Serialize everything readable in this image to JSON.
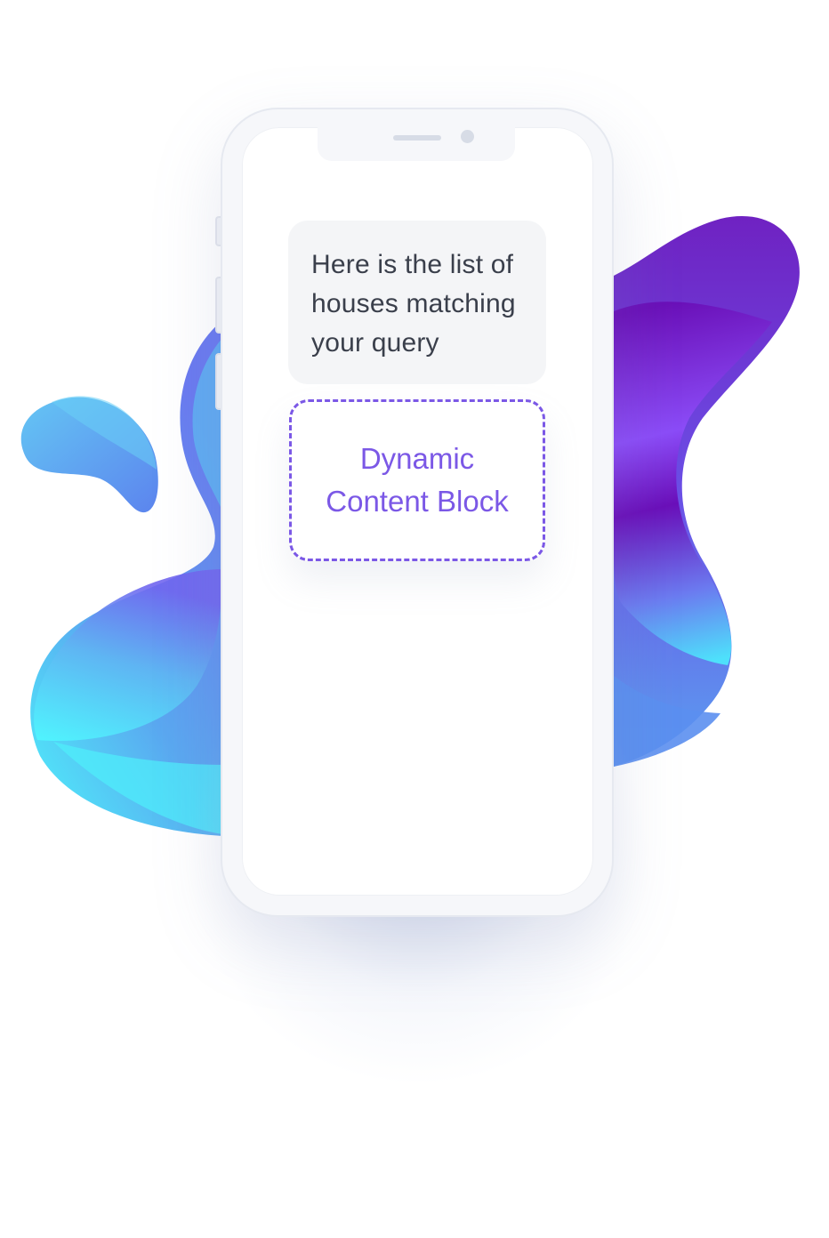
{
  "message": {
    "text": "Here is the list of houses matching your query"
  },
  "placeholder": {
    "label": "Dynamic Content Block"
  },
  "colors": {
    "accent": "#7b58e6",
    "bubble_bg": "#f4f5f7",
    "text": "#3a3f4b",
    "blob_cyan": "#4ef4fb",
    "blob_blue": "#5aa1f2",
    "blob_purple": "#6a10b8",
    "blob_violet": "#8a4cf5"
  }
}
